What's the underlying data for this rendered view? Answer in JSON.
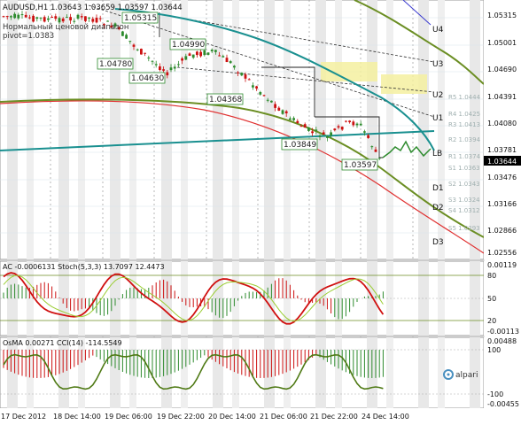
{
  "chart": {
    "symbol_header": "AUDUSD,H1  1.03643 1.03659 1.03597 1.03644",
    "indicator_name": "Нормальный ценовой диапазон",
    "pivot_label": "pivot=1.0383",
    "current_price": "1.03644",
    "price_ticks": [
      "1.05315",
      "1.05001",
      "1.04690",
      "1.04391",
      "1.04080",
      "1.03781",
      "1.03476",
      "1.03166",
      "1.02866",
      "1.02556"
    ],
    "price_label_values": [
      "1.05315",
      "1.04990",
      "1.04780",
      "1.04630",
      "1.04368",
      "1.03849",
      "1.03597"
    ],
    "level_names": [
      "U4",
      "U3",
      "U2",
      "U1",
      "LB",
      "D1",
      "D2",
      "D3"
    ],
    "pivot_levels": [
      "R5 1.0444",
      "R4 1.0425",
      "R3 1.0413",
      "R2 1.0394",
      "R1 1.0374",
      "S1 1.0363",
      "S2 1.0343",
      "S3 1.0324",
      "S4 1.0312",
      "S5 1.0293"
    ]
  },
  "ac_panel": {
    "header": "AC -0.0006131  Stoch(5,3,3) 13.7097 12.4473",
    "scale": [
      "0.00119",
      "80",
      "50",
      "20",
      "-0.00113"
    ]
  },
  "osma_panel": {
    "header": "OsMA 0.00271  CCI(14) -114.5549",
    "scale": [
      "0.00488",
      "100",
      "-100",
      "-0.00455"
    ]
  },
  "time_axis": [
    "17 Dec 2012",
    "18 Dec 14:00",
    "19 Dec 06:00",
    "19 Dec 22:00",
    "20 Dec 14:00",
    "21 Dec 06:00",
    "21 Dec 22:00",
    "24 Dec 14:00"
  ],
  "broker": {
    "logo_text": "alpari"
  },
  "colors": {
    "candle_up": "#2e8b2e",
    "candle_down": "#cc1111",
    "teal_ma": "#1a9090",
    "olive_ma": "#6b8e23",
    "red_ma": "#e03030",
    "zone": "#f5f0a0"
  }
}
